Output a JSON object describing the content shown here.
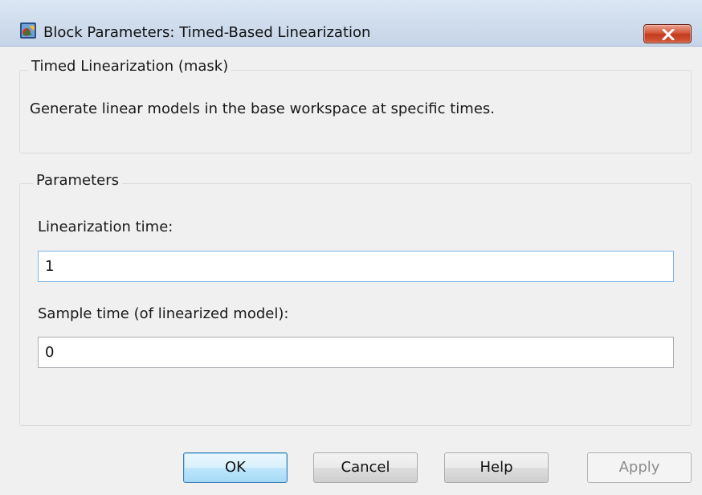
{
  "window": {
    "title": "Block Parameters: Timed-Based Linearization"
  },
  "icons": {
    "app": "simulink-block-icon",
    "close": "close-icon"
  },
  "mask_group": {
    "legend": "Timed Linearization (mask)",
    "description": "Generate linear models in the base workspace at specific times."
  },
  "params_group": {
    "legend": "Parameters",
    "linearization_time": {
      "label": "Linearization time:",
      "value": "1"
    },
    "sample_time": {
      "label": "Sample time (of linearized model):",
      "value": "0"
    }
  },
  "buttons": {
    "ok": "OK",
    "cancel": "Cancel",
    "help": "Help",
    "apply": "Apply"
  },
  "colors": {
    "close_button": "#c9452a",
    "focus_border": "#7eb4ea",
    "default_button_border": "#3c7fb1"
  }
}
